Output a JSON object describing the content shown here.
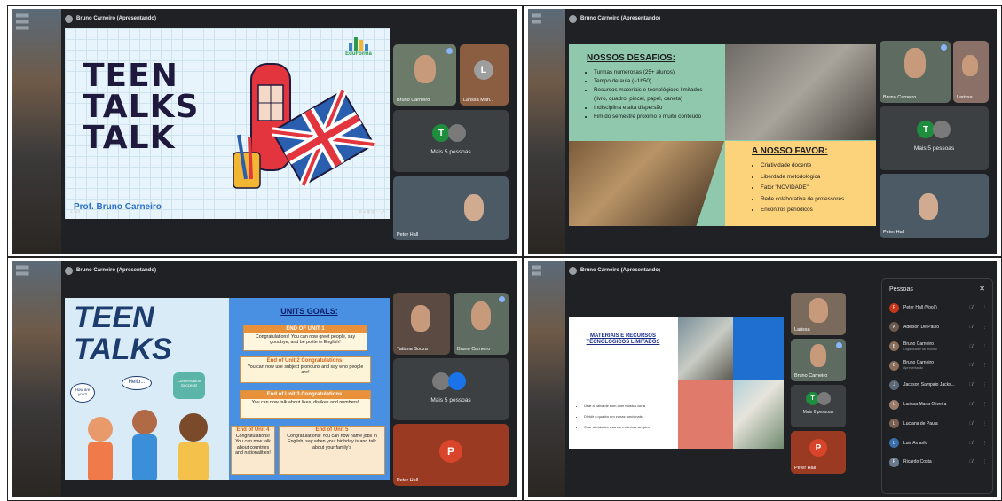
{
  "panels": [
    {
      "presenter": "Bruno Carneiro (Apresentando)",
      "slide": {
        "title": "TEEN TALKS TALK",
        "author": "Prof. Bruno Carneiro",
        "logo": "EduForma",
        "page": "1 / 23"
      },
      "tiles": [
        "Bruno Carneiro",
        "Larissa Mari...",
        "Mais 5 pessoas",
        "Peter Hall"
      ],
      "avatar_letters": {
        "larissa": "L",
        "more": "T"
      }
    },
    {
      "presenter": "Bruno Carneiro (Apresentando)",
      "slide": {
        "challenges_title": "NOSSOS DESAFIOS:",
        "challenges": [
          "Turmas numerosas (25+ alunos)",
          "Tempo de aula (~1h50)",
          "Recursos materiais e tecnológicos limitados",
          "(livro, quadro, pincel, papel, caneta)",
          "Indisciplina e alta dispersão",
          "Fim do semestre próximo e muito conteúdo"
        ],
        "favor_title": "A NOSSO FAVOR:",
        "favor": [
          "Criatividade docente",
          "Liberdade metodológica",
          "Fator \"NOVIDADE\"",
          "Rede colaborativa de professores",
          "Encontros periódicos"
        ]
      },
      "tiles": [
        "Bruno Carneiro",
        "Larissa",
        "Mais 5 pessoas",
        "Peter Hall"
      ],
      "avatar_letters": {
        "more": "T"
      }
    },
    {
      "presenter": "Bruno Carneiro (Apresentando)",
      "slide": {
        "title": "TEEN TALKS",
        "bubbles": [
          "How are you?",
          "Hello...",
          "Conversation Success!"
        ],
        "goals_title": "UNITS GOALS:",
        "u1_head": "END OF UNIT 1",
        "u1_text": "Congratulations! You can now greet people, say goodbye, and be polite in English!",
        "u2_head": "End of Unit 2 Congratulations!",
        "u2_text": "You can now use subject pronouns and say who people are!",
        "u3_head": "End of Unit 3 Congratulations!",
        "u3_text": "You can now talk about likes, dislikes and numbers!",
        "u4_head": "End of Unit 4",
        "u4_text": "Congratulations! You can now talk about countries and nationalities!",
        "u5_head": "End of Unit 5",
        "u5_text": "Congratulations! You can now name jobs in English, say when your birthday is and talk about your family's"
      },
      "tiles": [
        "Tatiana Souza",
        "Bruno Carneiro",
        "Mais 5 pessoas",
        "Peter Hall"
      ],
      "avatar_letters": {
        "peter": "P"
      }
    },
    {
      "presenter": "Bruno Carneiro (Apresentando)",
      "slide": {
        "title": "MATERIAIS E RECURSOS TECNOLÓGICOS LIMITADOS",
        "bullets": [
          "Usar a caixa de som com música curta",
          "Dividir o quadro em zonas funcionais",
          "Criar atividades usando materiais simples"
        ]
      },
      "tiles": [
        "Larissa",
        "Bruno Carneiro",
        "Mais 6 pessoas",
        "Peter Hall"
      ],
      "avatar_letters": {
        "peter": "P",
        "more": "T"
      },
      "people_panel": {
        "title": "Pessoas",
        "people": [
          {
            "name": "Peter Hall (Você)",
            "sub": "",
            "initial": "P",
            "color": "#c5361a"
          },
          {
            "name": "Adelson De Paulo",
            "sub": "",
            "initial": "A",
            "color": "#6b5a4e"
          },
          {
            "name": "Bruno Carneiro",
            "sub": "Organizador da reunião",
            "initial": "B",
            "color": "#8a6e5a"
          },
          {
            "name": "Bruno Carneiro",
            "sub": "Apresentação",
            "initial": "B",
            "color": "#8a6e5a"
          },
          {
            "name": "Jackson Sampaio Jacks...",
            "sub": "",
            "initial": "J",
            "color": "#5c6a78"
          },
          {
            "name": "Larissa Maria Oliveira",
            "sub": "",
            "initial": "L",
            "color": "#9a7a68"
          },
          {
            "name": "Luciana de Paula",
            "sub": "",
            "initial": "L",
            "color": "#7a6050"
          },
          {
            "name": "Luis Amarilo",
            "sub": "",
            "initial": "L",
            "color": "#3b6ea8"
          },
          {
            "name": "Ricardo Costa",
            "sub": "",
            "initial": "R",
            "color": "#6a7a8a"
          }
        ]
      }
    }
  ]
}
